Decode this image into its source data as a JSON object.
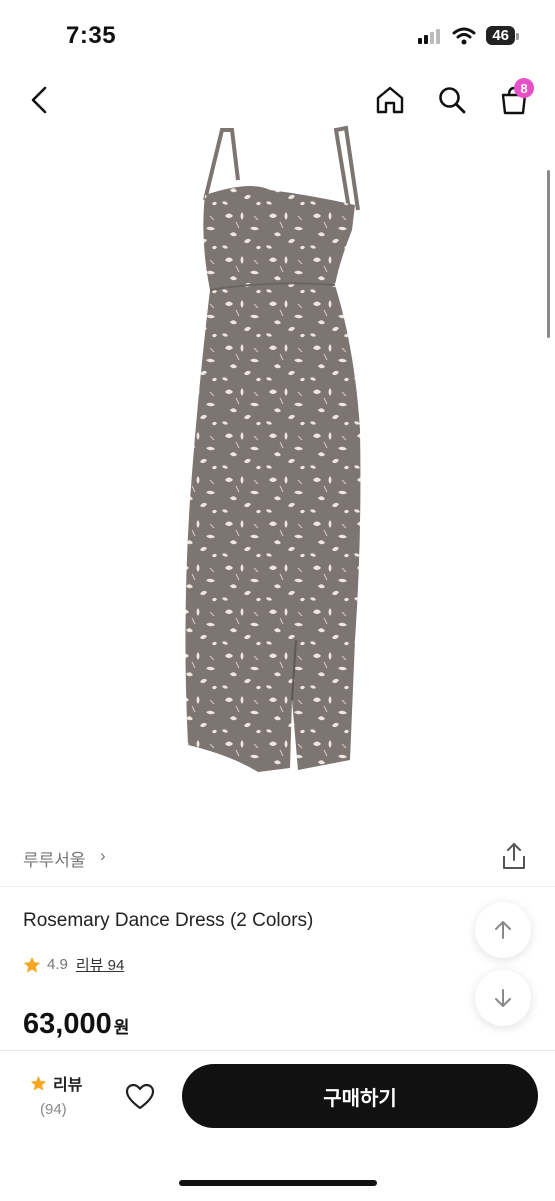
{
  "status": {
    "time": "7:35",
    "battery": "46"
  },
  "nav": {
    "cart_count": "8"
  },
  "product": {
    "brand": "루루서울",
    "brand_chevron": "›",
    "title": "Rosemary Dance Dress (2 Colors)",
    "rating": "4.9",
    "review_link": "리뷰 94",
    "price": "63,000",
    "price_unit": "원"
  },
  "bottom_bar": {
    "review_label": "리뷰",
    "review_count": "(94)",
    "buy_label": "구매하기"
  },
  "colors": {
    "accent_badge": "#e850c7",
    "star": "#f5a623",
    "buy_button": "#111111",
    "dress_base": "#7d7572",
    "dress_pattern": "#efe7df"
  },
  "icons": [
    "back-icon",
    "home-icon",
    "search-icon",
    "cart-icon",
    "share-icon",
    "arrow-up-icon",
    "arrow-down-icon",
    "star-icon",
    "heart-icon"
  ]
}
